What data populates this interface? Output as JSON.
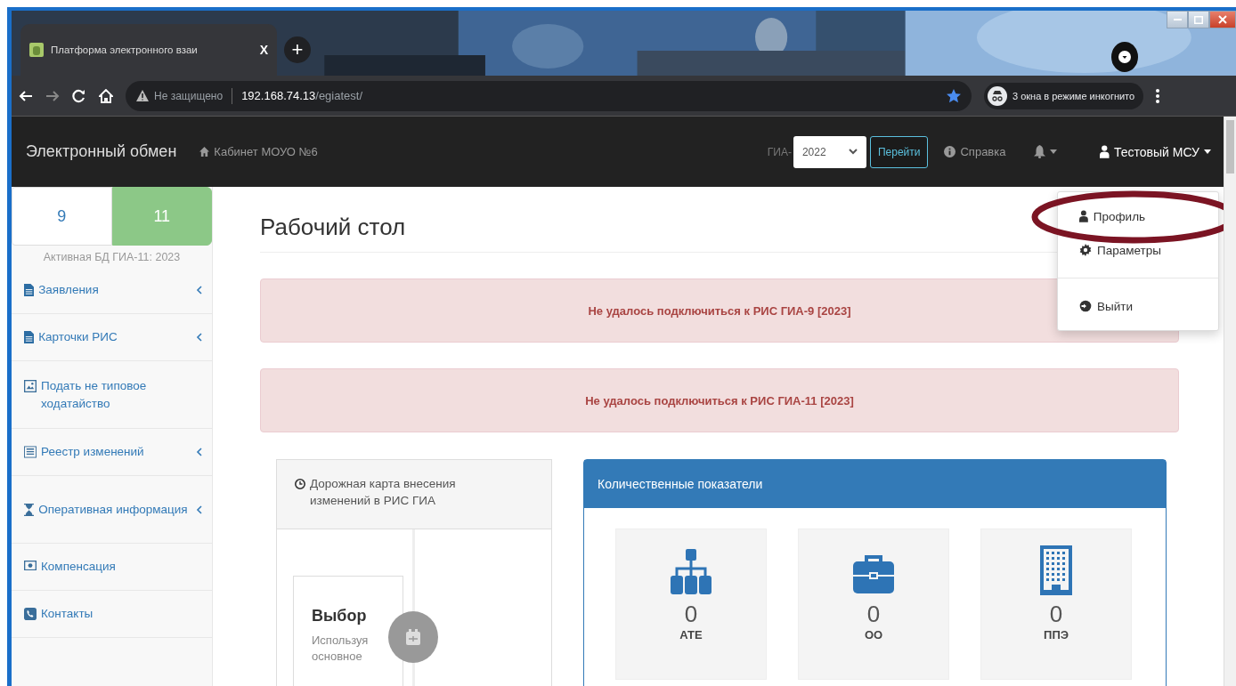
{
  "browser": {
    "tab": {
      "title": "Платформа электронного взаи",
      "close": "X"
    },
    "new_tab": "+",
    "address": {
      "security": "Не защищено",
      "host": "192.168.74.13",
      "path": "/egiatest/"
    },
    "incognito": "3 окна в режиме инкогнито"
  },
  "navbar": {
    "brand": "Электронный обмен",
    "cabinet": "Кабинет МОУО №6",
    "gia_label": "ГИА-",
    "year": "2022",
    "go_button": "Перейти",
    "help": "Справка",
    "user": "Тестовый МСУ"
  },
  "user_menu": {
    "items": [
      {
        "label": "Профиль",
        "kind": "user",
        "circled": true,
        "divider_before": false
      },
      {
        "label": "Параметры",
        "kind": "gear",
        "circled": false,
        "divider_before": false
      },
      {
        "label": "Выйти",
        "kind": "logout",
        "circled": false,
        "divider_before": true
      }
    ]
  },
  "sidebar": {
    "grade_tabs": [
      {
        "label": "9",
        "selected": false
      },
      {
        "label": "11",
        "selected": true
      }
    ],
    "active_db": "Активная БД ГИА-11: 2023",
    "items": [
      {
        "label": "Заявления",
        "kind": "file",
        "expandable": true
      },
      {
        "label": "Карточки РИС",
        "kind": "file",
        "expandable": true
      },
      {
        "label": "Подать не типовое ходатайство",
        "kind": "frame",
        "expandable": false
      },
      {
        "label": "Реестр изменений",
        "kind": "list",
        "expandable": true
      },
      {
        "label": "Оперативная информация",
        "kind": "hourglass",
        "expandable": true
      },
      {
        "label": "Компенсация",
        "kind": "money",
        "expandable": false
      },
      {
        "label": "Контакты",
        "kind": "phone",
        "expandable": false
      }
    ]
  },
  "page": {
    "title": "Рабочий стол",
    "alerts": [
      "Не удалось подключиться к РИС ГИА-9 [2023]",
      "Не удалось подключиться к РИС ГИА-11 [2023]"
    ],
    "roadmap": {
      "title": "Дорожная карта внесения изменений в РИС ГИА",
      "step": {
        "title": "Выбор",
        "text": "Используя основное"
      }
    },
    "stats": {
      "title": "Количественные показатели",
      "tiles": [
        {
          "kind": "sitemap",
          "value": "0",
          "label": "АТЕ"
        },
        {
          "kind": "briefcase",
          "value": "0",
          "label": "ОО"
        },
        {
          "kind": "building",
          "value": "0",
          "label": "ППЭ"
        }
      ]
    }
  }
}
